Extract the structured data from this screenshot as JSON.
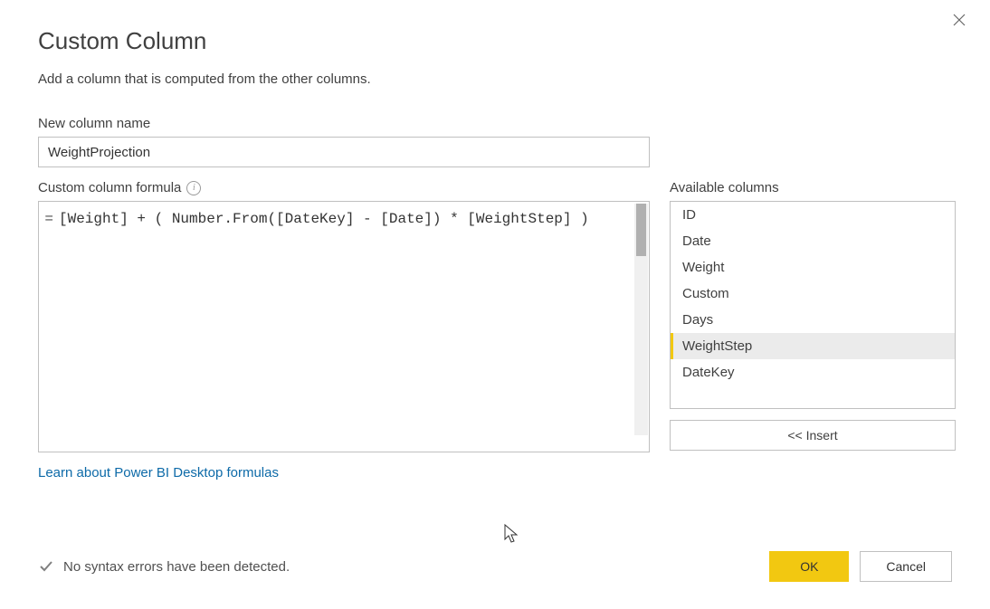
{
  "dialog": {
    "title": "Custom Column",
    "subtitle": "Add a column that is computed from the other columns."
  },
  "new_column": {
    "label": "New column name",
    "value": "WeightProjection"
  },
  "formula": {
    "label": "Custom column formula",
    "prefix": "=",
    "value": "[Weight] + ( Number.From([DateKey] - [Date]) * [WeightStep] )"
  },
  "available": {
    "label": "Available columns",
    "items": [
      "ID",
      "Date",
      "Weight",
      "Custom",
      "Days",
      "WeightStep",
      "DateKey"
    ],
    "selected_index": 5,
    "insert_label": "<< Insert"
  },
  "link": {
    "text": "Learn about Power BI Desktop formulas"
  },
  "status": {
    "text": "No syntax errors have been detected."
  },
  "buttons": {
    "ok": "OK",
    "cancel": "Cancel"
  }
}
